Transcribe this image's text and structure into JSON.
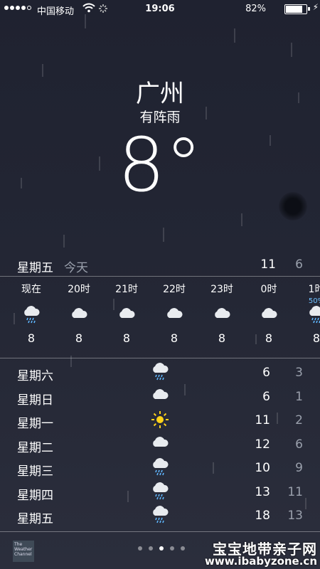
{
  "status": {
    "carrier": "中国移动",
    "time": "19:06",
    "battery_pct": "82%",
    "battery_level": 0.82
  },
  "weather": {
    "city": "广州",
    "condition": "有阵雨",
    "temperature": "8°"
  },
  "today": {
    "day": "星期五",
    "label": "今天",
    "high": "11",
    "low": "6"
  },
  "hourly": [
    {
      "time": "现在",
      "icon": "rain-cloud-icon",
      "temp": "8",
      "precip": ""
    },
    {
      "time": "20时",
      "icon": "cloud-icon",
      "temp": "8",
      "precip": ""
    },
    {
      "time": "21时",
      "icon": "cloud-icon",
      "temp": "8",
      "precip": ""
    },
    {
      "time": "22时",
      "icon": "cloud-icon",
      "temp": "8",
      "precip": ""
    },
    {
      "time": "23时",
      "icon": "cloud-icon",
      "temp": "8",
      "precip": ""
    },
    {
      "time": "0时",
      "icon": "cloud-icon",
      "temp": "8",
      "precip": ""
    },
    {
      "time": "1时",
      "icon": "rain-cloud-icon",
      "temp": "8",
      "precip": "50%"
    }
  ],
  "daily": [
    {
      "day": "星期六",
      "icon": "rain-cloud-icon",
      "high": "6",
      "low": "3"
    },
    {
      "day": "星期日",
      "icon": "cloud-icon",
      "high": "6",
      "low": "1"
    },
    {
      "day": "星期一",
      "icon": "sun-icon",
      "high": "11",
      "low": "2"
    },
    {
      "day": "星期二",
      "icon": "cloud-icon",
      "high": "12",
      "low": "6"
    },
    {
      "day": "星期三",
      "icon": "rain-cloud-icon",
      "high": "10",
      "low": "9"
    },
    {
      "day": "星期四",
      "icon": "rain-cloud-icon",
      "high": "13",
      "low": "11"
    },
    {
      "day": "星期五",
      "icon": "rain-cloud-icon",
      "high": "18",
      "low": "13"
    }
  ],
  "footer": {
    "provider_logo_text": "The Weather Channel",
    "page_count": 5,
    "active_page": 3,
    "watermark_cn": "宝宝地带亲子网",
    "watermark_url": "www.ibabyzone.cn"
  }
}
